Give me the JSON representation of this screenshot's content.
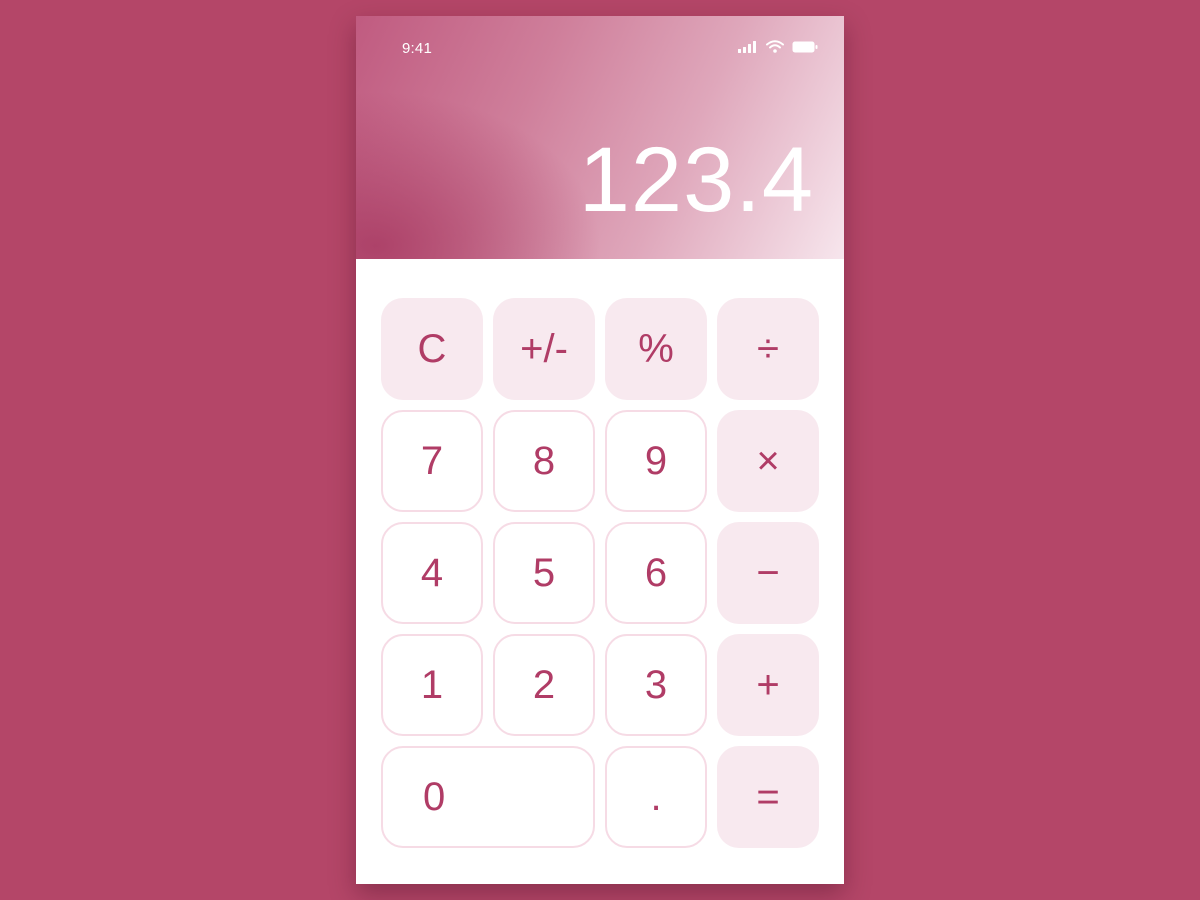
{
  "status_bar": {
    "time": "9:41",
    "icons": [
      "signal-icon",
      "wifi-icon",
      "battery-icon"
    ]
  },
  "display": {
    "value": "123.4"
  },
  "keys": {
    "clear": "C",
    "sign": "+/-",
    "percent": "%",
    "divide": "÷",
    "seven": "7",
    "eight": "8",
    "nine": "9",
    "multiply": "×",
    "four": "4",
    "five": "5",
    "six": "6",
    "subtract": "−",
    "one": "1",
    "two": "2",
    "three": "3",
    "add": "+",
    "zero": "0",
    "decimal": ".",
    "equals": "="
  },
  "colors": {
    "background": "#b44668",
    "accent": "#b03c66",
    "key_fill": "#f8e9ef",
    "key_border": "#f6dbe5"
  }
}
